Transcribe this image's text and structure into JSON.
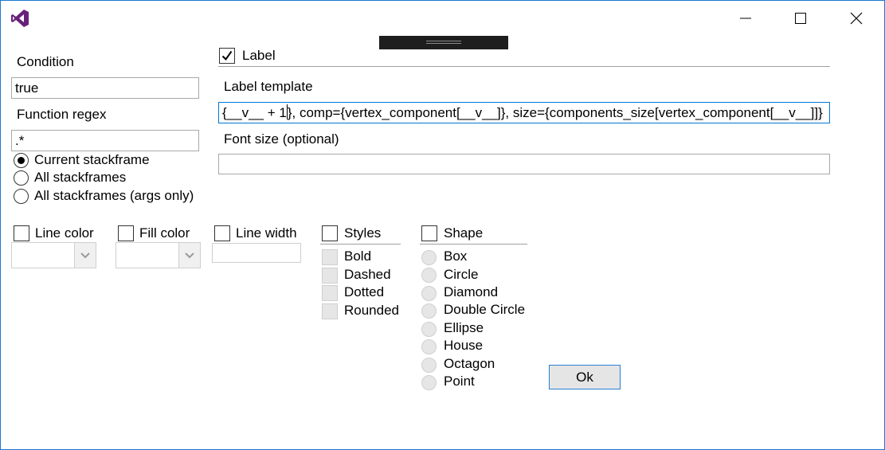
{
  "titlebar": {
    "app_icon": "visual-studio-icon",
    "minimize_icon": "minimize-icon",
    "maximize_icon": "maximize-icon",
    "close_icon": "close-icon"
  },
  "condition": {
    "label": "Condition",
    "value": "true"
  },
  "function_regex": {
    "label": "Function regex",
    "value": ".*"
  },
  "scope": {
    "options": [
      {
        "label": "Current stackframe",
        "selected": true
      },
      {
        "label": "All stackframes",
        "selected": false
      },
      {
        "label": "All stackframes (args only)",
        "selected": false
      }
    ]
  },
  "label_section": {
    "checkbox_label": "Label",
    "checked": true,
    "template_label": "Label template",
    "template_value_before_caret": "{__v__ + 1",
    "template_value_after_caret": "}, comp={vertex_component[__v__]}, size={components_size[vertex_component[__v__]]}",
    "font_size_label": "Font size (optional)",
    "font_size_value": ""
  },
  "line_color": {
    "label": "Line color",
    "checked": false,
    "value": ""
  },
  "fill_color": {
    "label": "Fill color",
    "checked": false,
    "value": ""
  },
  "line_width": {
    "label": "Line width",
    "checked": false,
    "value": ""
  },
  "styles": {
    "label": "Styles",
    "checked": false,
    "options": [
      "Bold",
      "Dashed",
      "Dotted",
      "Rounded"
    ]
  },
  "shape": {
    "label": "Shape",
    "checked": false,
    "options": [
      "Box",
      "Circle",
      "Diamond",
      "Double Circle",
      "Ellipse",
      "House",
      "Octagon",
      "Point"
    ]
  },
  "ok_button": {
    "label": "Ok"
  },
  "colors": {
    "window_border": "#1a78d2",
    "focus_border": "#0078d7",
    "vs_purple": "#68217a",
    "disabled_fill": "#e6e6e6"
  }
}
